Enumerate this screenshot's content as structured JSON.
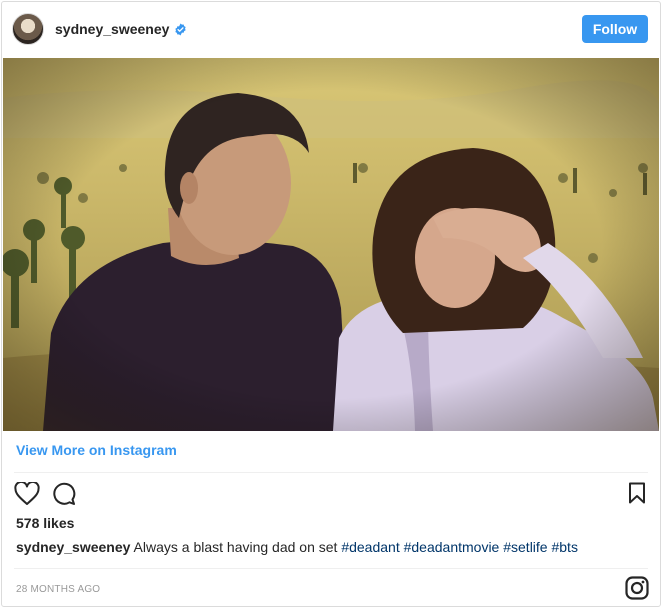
{
  "post": {
    "username": "sydney_sweeney",
    "verified_icon": "verified-badge-icon",
    "follow_label": "Follow",
    "view_more_label": "View More on Instagram",
    "likes_text": "578 likes",
    "caption_user": "sydney_sweeney",
    "caption_text": "Always a blast having dad on set",
    "caption_hashtags": "#deadant #deadantmovie #setlife #bts",
    "timestamp": "28 MONTHS AGO"
  },
  "icons": {
    "like": "heart-icon",
    "comment": "comment-icon",
    "save": "bookmark-icon",
    "brand": "instagram-logo-icon"
  },
  "colors": {
    "accent": "#3897f0",
    "hashtag": "#003569",
    "muted": "#999999"
  }
}
